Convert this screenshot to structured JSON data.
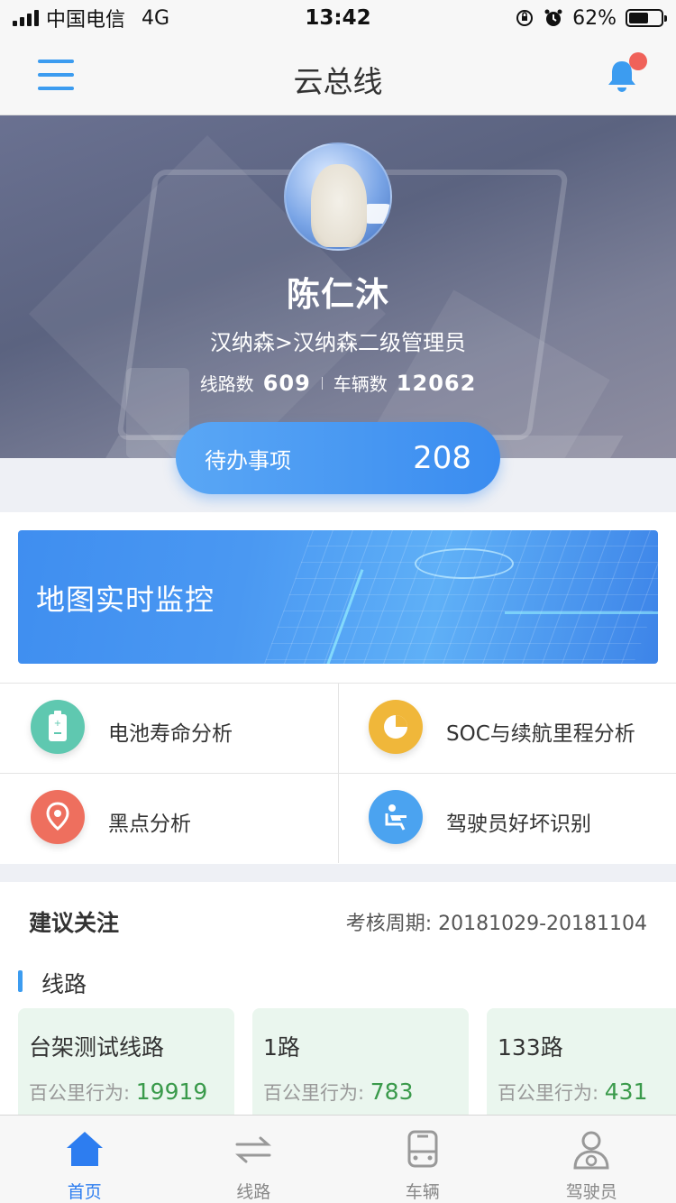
{
  "status_bar": {
    "carrier": "中国电信",
    "network": "4G",
    "time": "13:42",
    "battery": "62%",
    "battery_level": 0.62
  },
  "nav": {
    "title": "云总线",
    "menu_icon": "menu-icon",
    "bell_icon": "bell-icon",
    "has_notification": true
  },
  "profile": {
    "name": "陈仁沐",
    "role": "汉纳森>汉纳森二级管理员",
    "routes_label": "线路数",
    "routes_count": "609",
    "vehicles_label": "车辆数",
    "vehicles_count": "12062"
  },
  "todo": {
    "label": "待办事项",
    "count": "208"
  },
  "map_banner": {
    "title": "地图实时监控"
  },
  "features": [
    {
      "label": "电池寿命分析",
      "icon": "battery-icon",
      "color": "#5fc8b0"
    },
    {
      "label": "SOC与续航里程分析",
      "icon": "pie-chart-icon",
      "color": "#f0b73a"
    },
    {
      "label": "黑点分析",
      "icon": "location-pin-icon",
      "color": "#ee6f5e"
    },
    {
      "label": "驾驶员好坏识别",
      "icon": "driver-seat-icon",
      "color": "#4ba3f0"
    }
  ],
  "recommend": {
    "title": "建议关注",
    "period": "考核周期: 20181029-20181104",
    "section_label": "线路",
    "cards": [
      {
        "name": "台架测试线路",
        "metric_label": "百公里行为: ",
        "value": "19919"
      },
      {
        "name": "1路",
        "metric_label": "百公里行为: ",
        "value": "783"
      },
      {
        "name": "133路",
        "metric_label": "百公里行为: ",
        "value": "431"
      }
    ]
  },
  "tabs": [
    {
      "label": "首页",
      "icon": "home-icon",
      "active": true
    },
    {
      "label": "线路",
      "icon": "route-arrows-icon",
      "active": false
    },
    {
      "label": "车辆",
      "icon": "bus-icon",
      "active": false
    },
    {
      "label": "驾驶员",
      "icon": "driver-icon",
      "active": false
    }
  ],
  "colors": {
    "accent": "#3c9cf0",
    "active_tab": "#2d7df0",
    "metric_green": "#3a9a4b",
    "card_bg": "#eaf6ee",
    "notification_dot": "#f0625a"
  }
}
